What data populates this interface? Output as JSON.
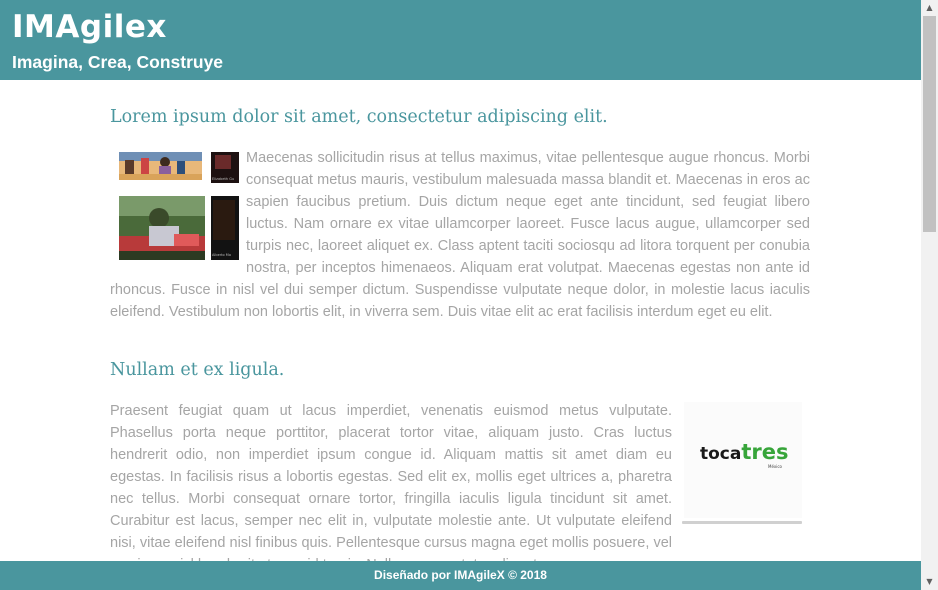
{
  "header": {
    "logo": "IMAgilex",
    "tagline": "Imagina, Crea, Construye"
  },
  "section1": {
    "heading": "Lorem ipsum dolor sit amet, consectetur adipiscing elit.",
    "body": "Maecenas sollicitudin risus at tellus maximus, vitae pellentesque augue rhoncus. Morbi consequat metus mauris, vestibulum malesuada massa blandit et. Maecenas in eros ac sapien faucibus pretium. Duis dictum neque eget ante tincidunt, sed feugiat libero luctus. Nam ornare ex vitae ullamcorper laoreet. Fusce lacus augue, ullamcorper sed turpis nec, laoreet aliquet ex. Class aptent taciti sociosqu ad litora torquent per conubia nostra, per inceptos himenaeos. Aliquam erat volutpat. Maecenas egestas non ante id rhoncus. Fusce in nisl vel dui semper dictum. Suspendisse vulputate neque dolor, in molestie lacus iaculis eleifend. Vestibulum non lobortis elit, in viverra sem. Duis vitae elit ac erat facilisis interdum eget eu elit.",
    "caption1": "Elizabeth Gu",
    "caption2": "Alberto Mo"
  },
  "section2": {
    "heading": "Nullam et ex ligula.",
    "body": "Praesent feugiat quam ut lacus imperdiet, venenatis euismod metus vulputate. Phasellus porta neque porttitor, placerat tortor vitae, aliquam justo. Cras luctus hendrerit odio, non imperdiet ipsum congue id. Aliquam mattis sit amet diam eu egestas. In facilisis risus a lobortis egestas. Sed elit ex, mollis eget ultrices a, pharetra nec tellus. Morbi consequat ornare tortor, fringilla iaculis ligula tincidunt sit amet. Curabitur est lacus, semper nec elit in, vulputate molestie ante. Ut vulputate eleifend nisi, vitae eleifend nisl finibus quis. Pellentesque cursus magna eget mollis posuere, vel maximus nisl hendrerit ut eros id turpis. Nullam consectetur aliquet purus."
  },
  "logo_toca": {
    "part1": "toca",
    "part2": "tres",
    "sub": "México"
  },
  "footer": {
    "text": "Diseñado por IMAgileX © 2018"
  },
  "colors": {
    "brand": "#4a969e",
    "body_text": "#a5a5a5",
    "toca_green": "#37a53a"
  }
}
